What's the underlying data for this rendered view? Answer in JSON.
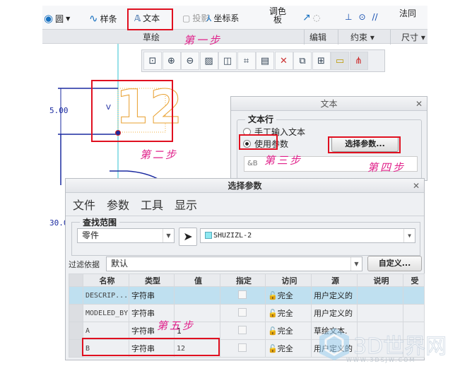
{
  "ribbon": {
    "circle": "圆",
    "spline": "样条",
    "text": "文本",
    "project": "投影",
    "coord_sys": "坐标系",
    "palette": "调色板",
    "normal": "法同",
    "groups": {
      "sketch": "草绘",
      "edit": "编辑",
      "constrain": "约束 ▾",
      "dimension": "尺寸 ▾"
    }
  },
  "graphics_toolbar": {
    "icons": [
      "refit-icon",
      "zoom-in-icon",
      "zoom-out-icon",
      "repaint-icon",
      "view-3d-icon",
      "named-view-icon",
      "sketch-view-icon",
      "datum-display-icon",
      "saved-view-icon",
      "dimension-display-icon",
      "constraint-display-icon",
      "vertex-display-icon",
      "grid-icon"
    ]
  },
  "canvas": {
    "dimension": "5.00",
    "dimension_left": "30.0",
    "vertex_label": "V",
    "sketch_text": "12"
  },
  "steps": {
    "s1": "第一步",
    "s2": "第二步",
    "s3": "第三步",
    "s4": "第四步",
    "s5": "第五步"
  },
  "text_dialog": {
    "title": "文本",
    "group": "文本行",
    "radio_manual": "手工输入文本",
    "radio_param": "使用参数",
    "radio_param_selected": true,
    "select_button": "选择参数...",
    "field_value": "&B"
  },
  "param_dialog": {
    "title": "选择参数",
    "menu": [
      "文件",
      "参数",
      "工具",
      "显示"
    ],
    "scope_group": "查找范围",
    "scope_type": "零件",
    "scope_model": "SHUZIZL-2",
    "filter_label": "过滤依据",
    "filter_value": "默认",
    "customize_button": "自定义...",
    "columns": [
      "名称",
      "类型",
      "值",
      "指定",
      "访问",
      "源",
      "说明",
      "受"
    ],
    "rows": [
      {
        "name": "DESCRIP...",
        "type": "字符串",
        "value": "",
        "access": "完全",
        "source": "用户定义的"
      },
      {
        "name": "MODELED_BY",
        "type": "字符串",
        "value": "",
        "access": "完全",
        "source": "用户定义的"
      },
      {
        "name": "A",
        "type": "字符串",
        "value": "1",
        "access": "完全",
        "source": "草绘文本."
      },
      {
        "name": "B",
        "type": "字符串",
        "value": "12",
        "access": "完全",
        "source": "用户定义的"
      }
    ]
  },
  "watermark": {
    "text": "3D世界网",
    "url_text": "WWW.3DSJW.COM"
  },
  "colors": {
    "step_annotation": "#e0208a",
    "highlight_box": "#e01020",
    "selected_row": "#bfe0f0"
  }
}
